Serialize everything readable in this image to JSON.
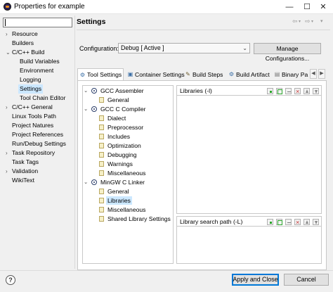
{
  "window": {
    "title": "Properties for example",
    "minimize": "—",
    "maximize": "☐",
    "close": "✕"
  },
  "filter": {
    "value": "",
    "placeholder": ""
  },
  "nav": {
    "items": [
      {
        "label": "Resource",
        "expandable": true
      },
      {
        "label": "Builders",
        "expandable": false
      },
      {
        "label": "C/C++ Build",
        "expandable": true,
        "expanded": true
      },
      {
        "label": "Build Variables",
        "child": true
      },
      {
        "label": "Environment",
        "child": true
      },
      {
        "label": "Logging",
        "child": true
      },
      {
        "label": "Settings",
        "child": true,
        "selected": true
      },
      {
        "label": "Tool Chain Editor",
        "child": true
      },
      {
        "label": "C/C++ General",
        "expandable": true
      },
      {
        "label": "Linux Tools Path",
        "expandable": false
      },
      {
        "label": "Project Natures",
        "expandable": false
      },
      {
        "label": "Project References",
        "expandable": false
      },
      {
        "label": "Run/Debug Settings",
        "expandable": false
      },
      {
        "label": "Task Repository",
        "expandable": true
      },
      {
        "label": "Task Tags",
        "expandable": false
      },
      {
        "label": "Validation",
        "expandable": true
      },
      {
        "label": "WikiText",
        "expandable": false
      }
    ]
  },
  "page": {
    "title": "Settings",
    "back_icon": "⇦",
    "forward_icon": "⇨",
    "menu_icon": "▾"
  },
  "configuration": {
    "label": "Configuration:",
    "value": "Debug  [ Active ]",
    "manage_label": "Manage Configurations..."
  },
  "tabs": [
    {
      "label": "Tool Settings",
      "icon": "tool-settings-icon",
      "active": true
    },
    {
      "label": "Container Settings",
      "icon": "container-icon"
    },
    {
      "label": "Build Steps",
      "icon": "build-steps-icon"
    },
    {
      "label": "Build Artifact",
      "icon": "build-artifact-icon"
    },
    {
      "label": "Binary Pa",
      "icon": "binary-parsers-icon"
    }
  ],
  "tool_tree": [
    {
      "label": "GCC Assembler",
      "level": 0
    },
    {
      "label": "General",
      "level": 1
    },
    {
      "label": "GCC C Compiler",
      "level": 0
    },
    {
      "label": "Dialect",
      "level": 1
    },
    {
      "label": "Preprocessor",
      "level": 1
    },
    {
      "label": "Includes",
      "level": 1
    },
    {
      "label": "Optimization",
      "level": 1
    },
    {
      "label": "Debugging",
      "level": 1
    },
    {
      "label": "Warnings",
      "level": 1
    },
    {
      "label": "Miscellaneous",
      "level": 1
    },
    {
      "label": "MinGW C Linker",
      "level": 0
    },
    {
      "label": "General",
      "level": 1
    },
    {
      "label": "Libraries",
      "level": 1,
      "selected": true
    },
    {
      "label": "Miscellaneous",
      "level": 1
    },
    {
      "label": "Shared Library Settings",
      "level": 1
    }
  ],
  "libraries": {
    "header": "Libraries (-l)",
    "items": []
  },
  "library_paths": {
    "header": "Library search path (-L)",
    "items": []
  },
  "footer": {
    "help_label": "?",
    "apply_close_label": "Apply and Close",
    "cancel_label": "Cancel"
  }
}
